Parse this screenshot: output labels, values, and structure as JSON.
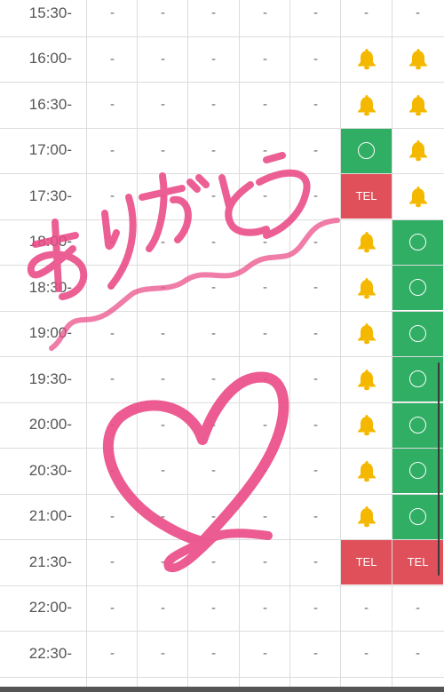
{
  "schedule": {
    "rows": [
      {
        "time": "15:30-",
        "cells": [
          "-",
          "-",
          "-",
          "-",
          "-",
          "-",
          "-"
        ]
      },
      {
        "time": "16:00-",
        "cells": [
          "-",
          "-",
          "-",
          "-",
          "-",
          "bell",
          "bell"
        ]
      },
      {
        "time": "16:30-",
        "cells": [
          "-",
          "-",
          "-",
          "-",
          "-",
          "bell",
          "bell"
        ]
      },
      {
        "time": "17:00-",
        "cells": [
          "-",
          "-",
          "-",
          "-",
          "-",
          "circle",
          "bell"
        ]
      },
      {
        "time": "17:30-",
        "cells": [
          "-",
          "-",
          "-",
          "-",
          "-",
          "TEL",
          "bell"
        ]
      },
      {
        "time": "18:00-",
        "cells": [
          "-",
          "-",
          "-",
          "-",
          "-",
          "bell",
          "circle"
        ]
      },
      {
        "time": "18:30-",
        "cells": [
          "-",
          "-",
          "-",
          "-",
          "-",
          "bell",
          "circle"
        ]
      },
      {
        "time": "19:00-",
        "cells": [
          "-",
          "-",
          "-",
          "-",
          "-",
          "bell",
          "circle"
        ]
      },
      {
        "time": "19:30-",
        "cells": [
          "-",
          "-",
          "-",
          "-",
          "-",
          "bell",
          "circle"
        ]
      },
      {
        "time": "20:00-",
        "cells": [
          "-",
          "-",
          "-",
          "-",
          "-",
          "bell",
          "circle"
        ]
      },
      {
        "time": "20:30-",
        "cells": [
          "-",
          "-",
          "-",
          "-",
          "-",
          "bell",
          "circle"
        ]
      },
      {
        "time": "21:00-",
        "cells": [
          "-",
          "-",
          "-",
          "-",
          "-",
          "bell",
          "circle"
        ]
      },
      {
        "time": "21:30-",
        "cells": [
          "-",
          "-",
          "-",
          "-",
          "-",
          "TEL",
          "TEL"
        ]
      },
      {
        "time": "22:00-",
        "cells": [
          "-",
          "-",
          "-",
          "-",
          "-",
          "-",
          "-"
        ]
      },
      {
        "time": "22:30-",
        "cells": [
          "-",
          "-",
          "-",
          "-",
          "-",
          "-",
          "-"
        ]
      }
    ]
  },
  "handwriting": {
    "text": "ありがとう",
    "color": "#ea4a86",
    "decorations": [
      "wavy-line-icon",
      "heart-icon"
    ]
  },
  "colors": {
    "available": "#2fae64",
    "tel": "#e0505a",
    "bell": "#f5b800"
  }
}
